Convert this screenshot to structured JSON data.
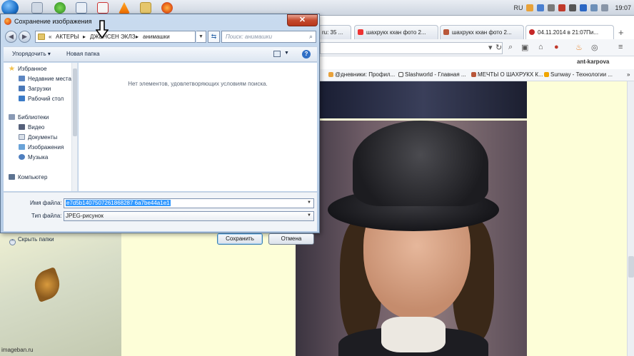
{
  "taskbar": {
    "lang": "RU",
    "clock": "19:07"
  },
  "browser": {
    "tabs": [
      {
        "label": "ru: 35 ..."
      },
      {
        "label": "шахрукх кхан фото 2..."
      },
      {
        "label": "шахрукх кхан фото 2..."
      },
      {
        "label": "04.11.2014 в 21:07Пи..."
      }
    ],
    "new_tab": "+",
    "user_name": "ant-karpova",
    "bookmarks": [
      {
        "label": "@дневники: Профил..."
      },
      {
        "label": "Slashworld - Главная ..."
      },
      {
        "label": "МЕЧТЫ О ШАХРУКХ К..."
      },
      {
        "label": "Sunway - Технологии ..."
      }
    ],
    "watermark": "imageban.ru"
  },
  "dialog": {
    "title": "Сохранение изображения",
    "close_label": "✕",
    "breadcrumb": {
      "prefix": "«",
      "parts": [
        "АКТЕРЫ",
        "ДЖЕНСЕН ЭКЛЗ",
        "анимашки"
      ],
      "separator": "▸"
    },
    "search_placeholder": "Поиск: анимашки",
    "toolbar": {
      "organize": "Упорядочить ▾",
      "new_folder": "Новая папка",
      "help": "?"
    },
    "nav": {
      "favorites": "Избранное",
      "favorites_items": [
        "Недавние места",
        "Загрузки",
        "Рабочий стол"
      ],
      "libraries": "Библиотеки",
      "libraries_items": [
        "Видео",
        "Документы",
        "Изображения",
        "Музыка"
      ],
      "computer": "Компьютер"
    },
    "empty_message": "Нет элементов, удовлетворяющих условиям поиска.",
    "filename_label": "Имя файла:",
    "filename_value": "e7d5b1407507261868287 6a7be44a1e1",
    "filetype_label": "Тип файла:",
    "filetype_value": "JPEG-рисунок",
    "hide_folders": "Скрыть папки",
    "save_label": "Сохранить",
    "cancel_label": "Отмена"
  },
  "colors": {
    "dialog_frame": "#b5cbe5",
    "selection": "#3399ff",
    "page_background": "#fdfed8"
  }
}
